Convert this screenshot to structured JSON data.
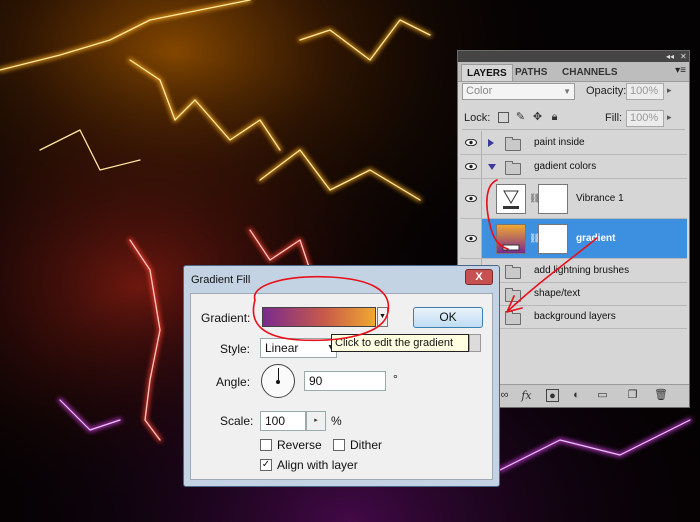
{
  "colors": {
    "selection": "#3d8fe0",
    "annotation_red": "#e8101a",
    "gradient_start": "#7a2a8e",
    "gradient_end": "#f0a830"
  },
  "layers_panel": {
    "tabs": [
      {
        "label": "LAYERS",
        "active": true
      },
      {
        "label": "PATHS",
        "active": false
      },
      {
        "label": "CHANNELS",
        "active": false
      }
    ],
    "blend_mode": "Color",
    "opacity_label": "Opacity:",
    "opacity_value": "100%",
    "lock_label": "Lock:",
    "fill_label": "Fill:",
    "fill_value": "100%",
    "layers": [
      {
        "name": "paint inside",
        "type": "group",
        "expanded": false,
        "visible": true
      },
      {
        "name": "gadient colors",
        "type": "group",
        "expanded": true,
        "visible": true
      },
      {
        "name": "Vibrance 1",
        "type": "adjustment",
        "visible": true
      },
      {
        "name": "gradient",
        "type": "fill",
        "visible": true,
        "selected": true
      },
      {
        "name": "add lightning brushes",
        "type": "group",
        "expanded": false,
        "visible": true
      },
      {
        "name": "shape/text",
        "type": "group",
        "expanded": false,
        "visible": true
      },
      {
        "name": "background layers",
        "type": "group",
        "expanded": false,
        "visible": true
      }
    ],
    "bottom_icons": [
      "link-icon",
      "fx-icon",
      "mask-icon",
      "adjustment-icon",
      "folder-icon",
      "new-layer-icon",
      "trash-icon"
    ]
  },
  "dialog": {
    "title": "Gradient Fill",
    "close_label": "X",
    "gradient_label": "Gradient:",
    "ok_label": "OK",
    "style_label": "Style:",
    "style_value": "Linear",
    "angle_label": "Angle:",
    "angle_value": "90",
    "angle_unit": "°",
    "scale_label": "Scale:",
    "scale_value": "100",
    "scale_unit": "%",
    "reverse_label": "Reverse",
    "reverse_checked": false,
    "dither_label": "Dither",
    "dither_checked": false,
    "align_label": "Align with layer",
    "align_checked": true,
    "tooltip": "Click to edit the gradient"
  }
}
